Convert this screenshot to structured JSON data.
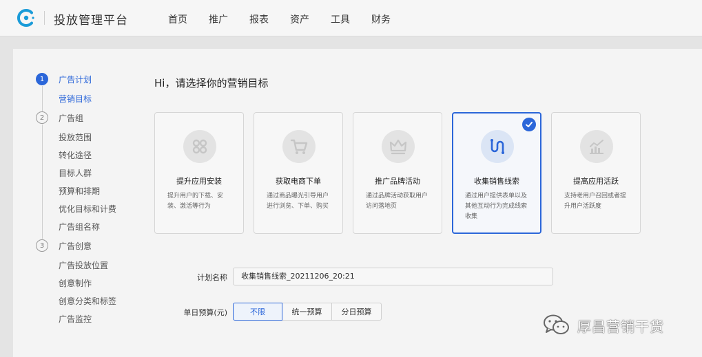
{
  "header": {
    "brand": "投放管理平台",
    "nav": [
      "首页",
      "推广",
      "报表",
      "资产",
      "工具",
      "财务"
    ]
  },
  "steps": [
    {
      "number": "1",
      "title": "广告计划",
      "items": [
        "营销目标"
      ]
    },
    {
      "number": "2",
      "title": "广告组",
      "items": [
        "投放范围",
        "转化途径",
        "目标人群",
        "预算和排期",
        "优化目标和计费",
        "广告组名称"
      ]
    },
    {
      "number": "3",
      "title": "广告创意",
      "items": [
        "广告投放位置",
        "创意制作",
        "创意分类和标签",
        "广告监控"
      ]
    }
  ],
  "main": {
    "heading": "Hi，请选择你的营销目标",
    "goals": [
      {
        "title": "提升应用安装",
        "desc": "提升用户的下载、安装、激活等行为",
        "icon": "app-grid-icon"
      },
      {
        "title": "获取电商下单",
        "desc": "通过商品曝光引导用户进行浏览、下单、购买",
        "icon": "shopping-cart-icon"
      },
      {
        "title": "推广品牌活动",
        "desc": "通过品牌活动获取用户访问落地页",
        "icon": "crown-icon"
      },
      {
        "title": "收集销售线索",
        "desc": "通过用户提供表单以及其他互动行为完成线索收集",
        "icon": "lead-flow-icon"
      },
      {
        "title": "提高应用活跃",
        "desc": "支持老用户召回或者提升用户活跃度",
        "icon": "trend-chart-icon"
      }
    ],
    "selected_goal": "收集销售线索"
  },
  "form": {
    "plan_name_label": "计划名称",
    "plan_name_value": "收集销售线索_20211206_20:21",
    "budget_label": "单日预算(元)",
    "budget_options": [
      "不限",
      "统一预算",
      "分日预算"
    ],
    "budget_selected": "不限"
  },
  "watermark": {
    "text": "厚昌营销干货"
  },
  "colors": {
    "accent": "#2b66d9",
    "logo": "#1a9bd8"
  }
}
